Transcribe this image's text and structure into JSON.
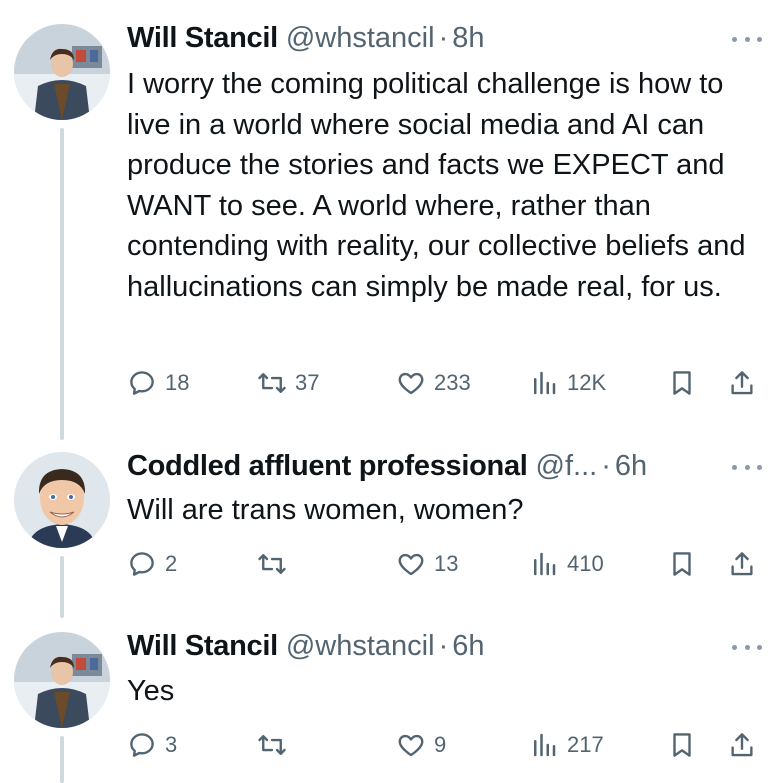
{
  "tweets": [
    {
      "name": "Will Stancil",
      "handle": "@whstancil",
      "dot": "·",
      "time": "8h",
      "text": "I worry the coming political challenge is how to live in a world where social media and AI can produce the stories and facts we EXPECT and WANT to see. A world where, rather than contending with reality, our collective beliefs and hallucinations can simply be made real, for us.",
      "replies": "18",
      "retweets": "37",
      "likes": "233",
      "views": "12K"
    },
    {
      "name": "Coddled affluent professional",
      "handle": "@f...",
      "dot": "·",
      "time": "6h",
      "text": "Will are trans women, women?",
      "replies": "2",
      "retweets": "",
      "likes": "13",
      "views": "410"
    },
    {
      "name": "Will Stancil",
      "handle": "@whstancil",
      "dot": "·",
      "time": "6h",
      "text": "Yes",
      "replies": "3",
      "retweets": "",
      "likes": "9",
      "views": "217"
    }
  ],
  "icons": {
    "reply": "reply-icon",
    "retweet": "retweet-icon",
    "like": "heart-icon",
    "views": "views-icon",
    "bookmark": "bookmark-icon",
    "share": "share-icon",
    "more": "more-icon"
  },
  "colors": {
    "text": "#0f1419",
    "secondary": "#536471",
    "thread_line": "#cfd9de"
  }
}
